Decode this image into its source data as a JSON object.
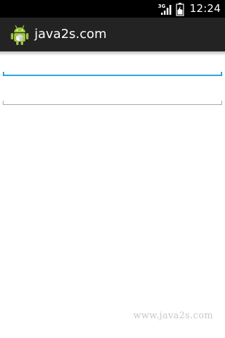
{
  "status_bar": {
    "network_type": "3G",
    "time": "12:24",
    "icons": [
      "signal-icon",
      "battery-icon"
    ]
  },
  "action_bar": {
    "title": "java2s.com",
    "icon": "android-app-icon"
  },
  "fields": [
    {
      "value": "",
      "placeholder": "",
      "focused": true
    },
    {
      "value": "",
      "placeholder": "",
      "focused": false
    }
  ],
  "watermark": "www.java2s.com",
  "colors": {
    "status_bar": "#000000",
    "action_bar": "#232323",
    "focus_accent": "#2ea2d8",
    "inactive_line": "#a8a8a8",
    "background": "#ffffff"
  }
}
